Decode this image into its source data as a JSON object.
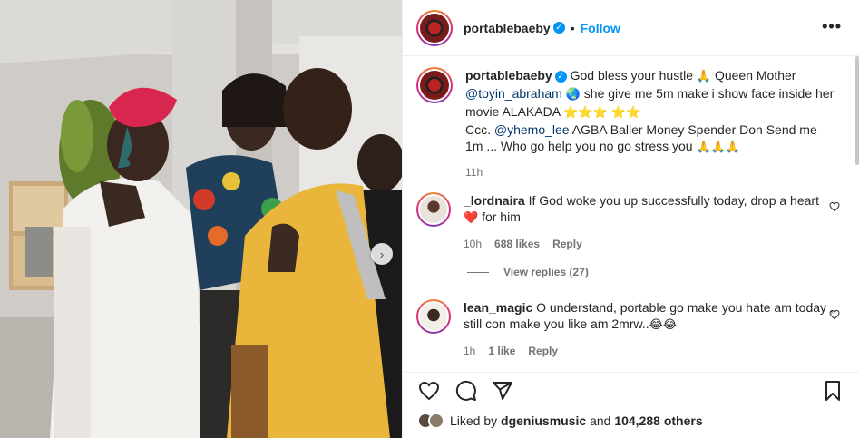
{
  "post": {
    "author": "portablebaeby",
    "follow_label": "Follow",
    "more_label": "•••",
    "dot": "•"
  },
  "caption": {
    "username": "portablebaeby",
    "part1": " God bless your hustle ",
    "emoji_pray": "🙏",
    "part2": " Queen Mother ",
    "mention1": "@toyin_abraham",
    "emoji_globe": "🌏",
    "part3": " she give me 5m make i show face inside her movie ALAKADA ",
    "emoji_stars": "⭐⭐⭐ ⭐⭐",
    "part4": " Ccc. ",
    "mention2": "@yhemo_lee",
    "part5": " AGBA Baller Money Spender Don Send me 1m ... Who go help you no go stress you ",
    "emoji_pray3": "🙏🙏🙏",
    "time": "11h"
  },
  "comments": [
    {
      "username": "_lordnaira",
      "text": " If God woke you up successfully today, drop a heart ",
      "emoji": "❤️",
      "text2": " for him",
      "time": "10h",
      "likes": "688 likes",
      "reply_label": "Reply",
      "view_replies": "View replies (27)"
    },
    {
      "username": "lean_magic",
      "text": " O understand, portable go make you hate am today , still con make you like am 2mrw..",
      "emoji": "😂😂",
      "time": "1h",
      "likes": "1 like",
      "reply_label": "Reply"
    }
  ],
  "likes": {
    "prefix": "Liked by ",
    "user": "dgeniusmusic",
    "middle": " and ",
    "count": "104,288 others"
  },
  "icons": {
    "heart": "heart-icon",
    "comment": "comment-icon",
    "share": "share-icon",
    "save": "bookmark-icon",
    "more": "more-options-icon",
    "verified": "verified-badge-icon",
    "next": "chevron-right-icon"
  },
  "colors": {
    "accent": "#0095f6",
    "mention": "#00376b",
    "muted": "#737373",
    "heart_red": "#ed4956"
  }
}
